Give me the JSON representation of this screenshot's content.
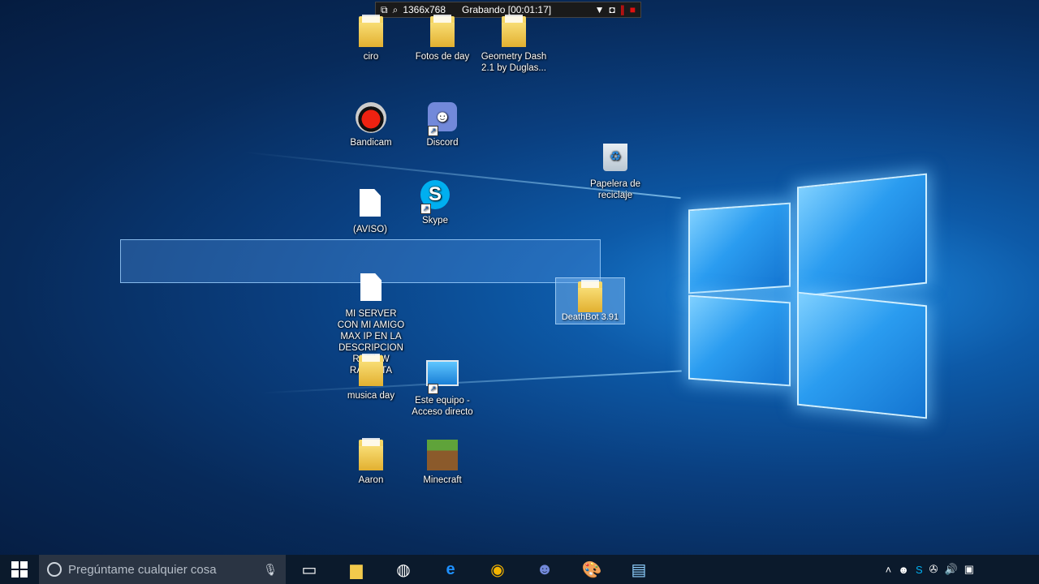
{
  "recorder": {
    "resolution": "1366x768",
    "status": "Grabando [00:01:17]"
  },
  "desktop": {
    "icons": [
      {
        "label": "ciro"
      },
      {
        "label": "Fotos de day"
      },
      {
        "label": "Geometry Dash 2.1 by Duglas..."
      },
      {
        "label": "Bandicam"
      },
      {
        "label": "Discord"
      },
      {
        "label": "Papelera de reciclaje"
      },
      {
        "label": "(AVISO)"
      },
      {
        "label": "Skype"
      },
      {
        "label": "MI SERVER CON MI AMIGO MAX IP EN LA DESCRIPCION REVIEW RAPIDITA"
      },
      {
        "label": "musica day"
      },
      {
        "label": "Este equipo - Acceso directo"
      },
      {
        "label": "Aaron"
      },
      {
        "label": "Minecraft"
      }
    ],
    "dragging_label": "DeathBot 3.91"
  },
  "taskbar": {
    "search_placeholder": "Pregúntame cualquier cosa"
  },
  "colors": {
    "taskbar_bg": "#0b1a2c",
    "accent": "#1a7fd6"
  }
}
